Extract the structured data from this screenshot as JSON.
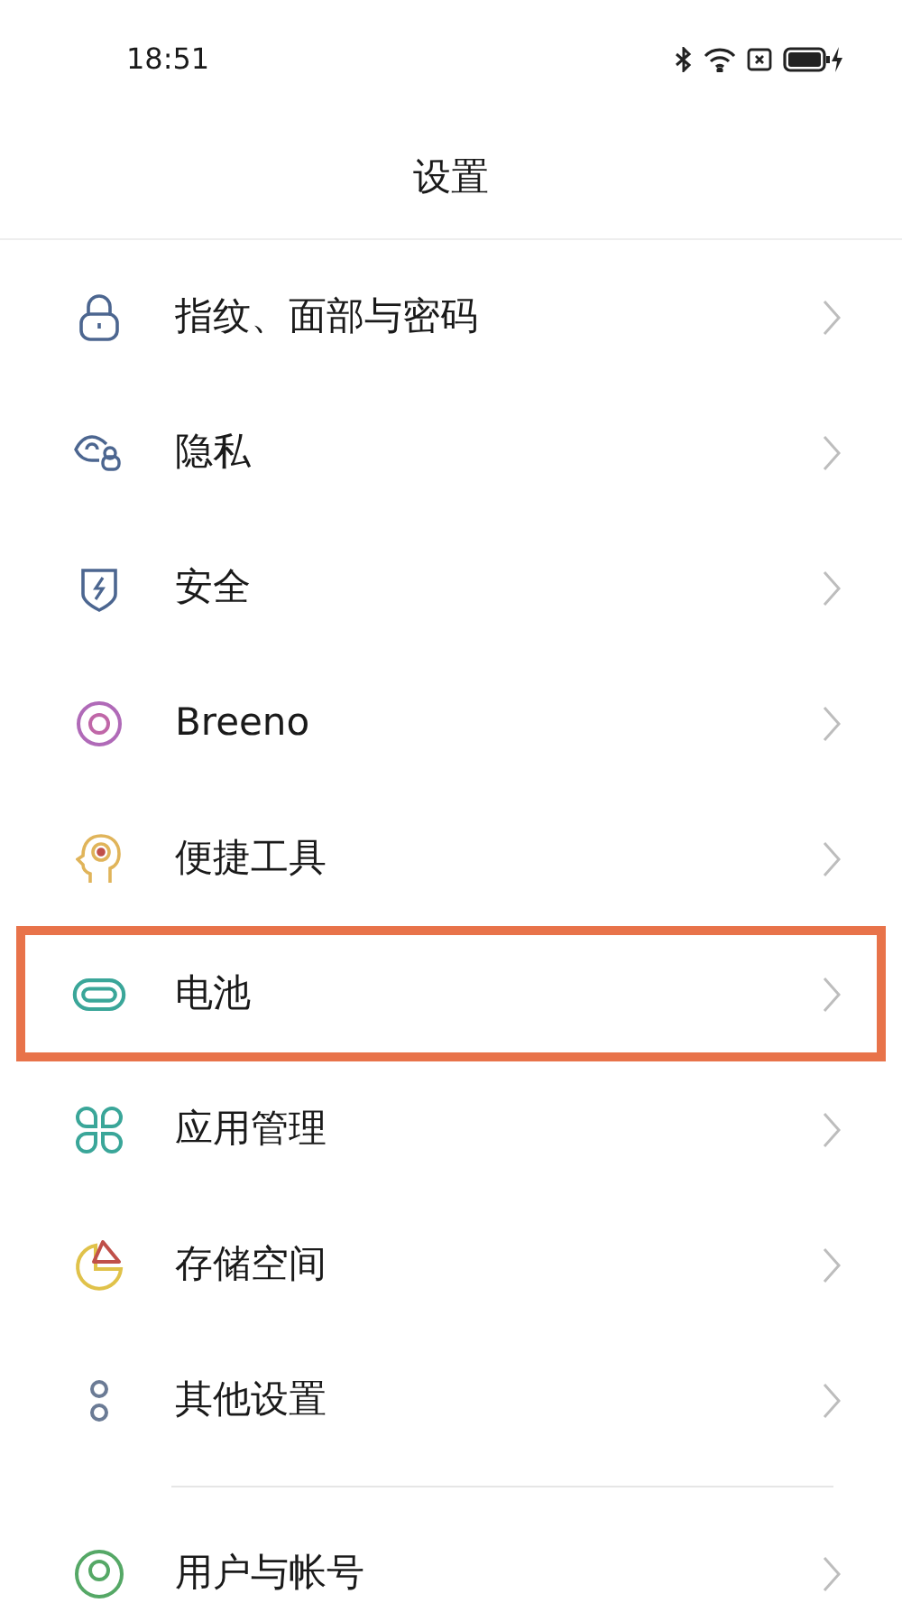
{
  "status_bar": {
    "time": "18:51"
  },
  "title": "设置",
  "sections": [
    {
      "items": [
        {
          "label": "指纹、面部与密码",
          "kind": "lock",
          "highlighted": false
        },
        {
          "label": "隐私",
          "kind": "eye",
          "highlighted": false
        },
        {
          "label": "安全",
          "kind": "shield",
          "highlighted": false
        },
        {
          "label": "Breeno",
          "kind": "ring",
          "highlighted": false
        },
        {
          "label": "便捷工具",
          "kind": "head",
          "highlighted": false
        },
        {
          "label": "电池",
          "kind": "battery",
          "highlighted": true
        },
        {
          "label": "应用管理",
          "kind": "apps",
          "highlighted": false
        },
        {
          "label": "存储空间",
          "kind": "pie",
          "highlighted": false
        },
        {
          "label": "其他设置",
          "kind": "dots",
          "highlighted": false
        }
      ]
    },
    {
      "items": [
        {
          "label": "用户与帐号",
          "kind": "user",
          "highlighted": false
        }
      ]
    }
  ]
}
